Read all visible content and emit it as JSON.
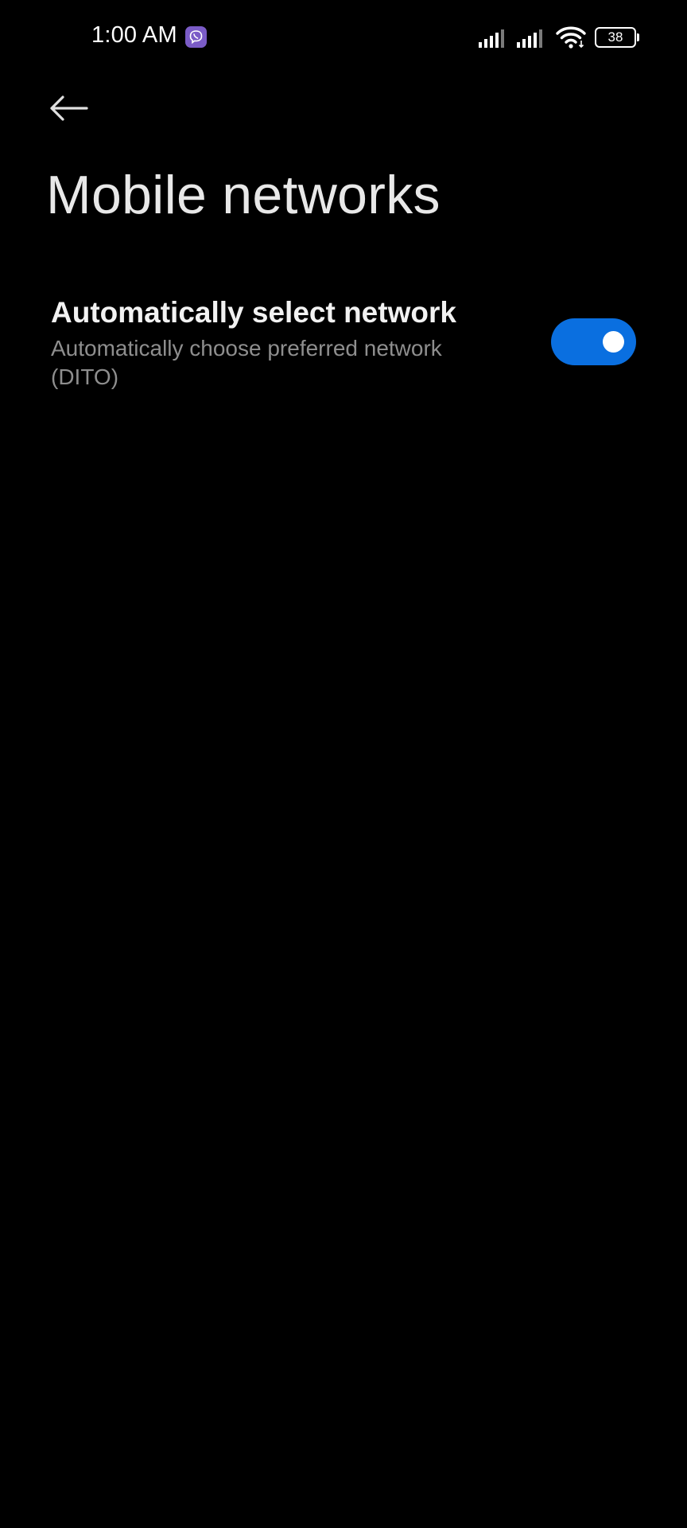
{
  "status_bar": {
    "time": "1:00 AM",
    "notification_icon": "viber-icon",
    "signal_icons": [
      "signal-icon",
      "signal-icon"
    ],
    "wifi_icon": "wifi-icon",
    "battery_level": "38"
  },
  "header": {
    "back_icon": "back-arrow-icon",
    "title": "Mobile networks"
  },
  "settings": {
    "auto_select": {
      "title": "Automatically select network",
      "subtitle": "Automatically choose preferred network (DITO)",
      "enabled": true
    }
  },
  "colors": {
    "background": "#000000",
    "toggle_on": "#0a6fe0",
    "subtitle": "#8e8e8e",
    "viber": "#7b5cc7"
  }
}
